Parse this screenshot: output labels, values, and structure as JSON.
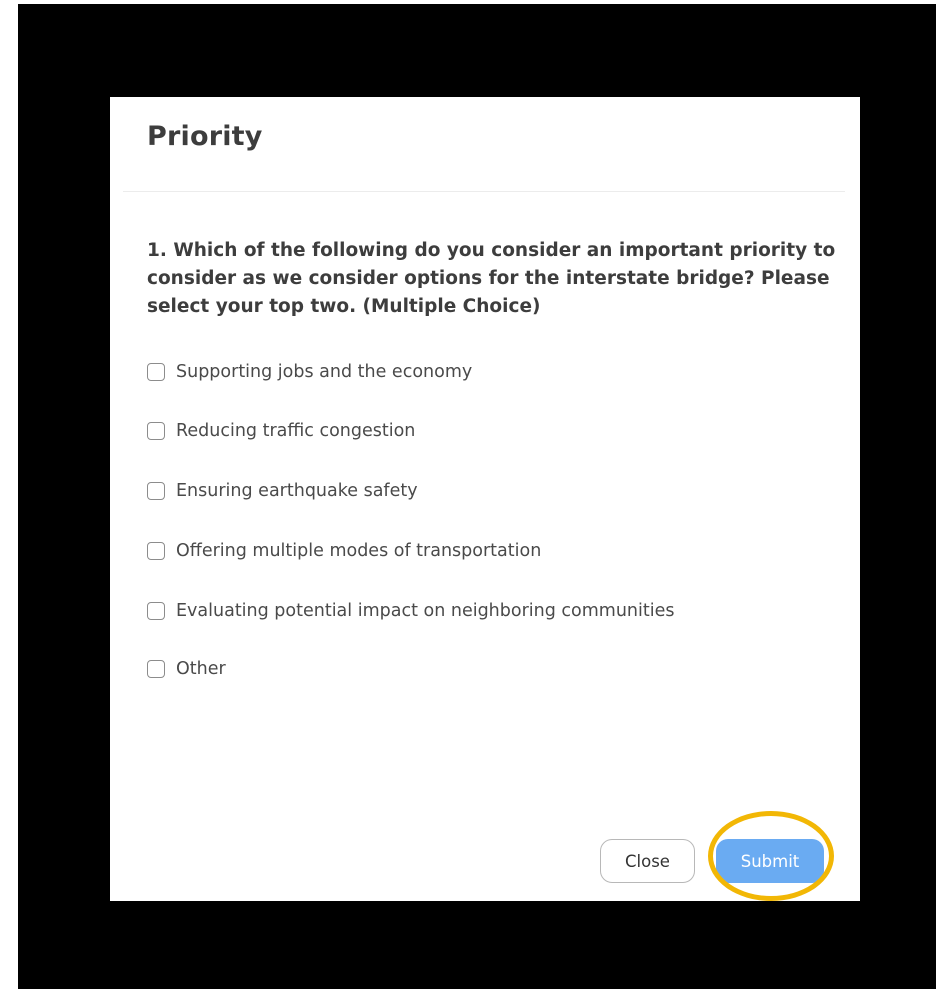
{
  "dialog": {
    "title": "Priority",
    "question": "1. Which of the following do you consider an important priority to consider as we consider options for the interstate bridge? Please select your top two. (Multiple Choice)",
    "options": [
      "Supporting jobs and the economy",
      "Reducing traffic congestion",
      "Ensuring earthquake safety",
      "Offering multiple modes of transportation",
      "Evaluating potential impact on neighboring communities",
      "Other"
    ],
    "close_label": "Close",
    "submit_label": "Submit"
  },
  "colors": {
    "backdrop": "#000000",
    "submit_button": "#6aabf2",
    "highlight_ring": "#f2b705",
    "text": "#3d3d3d"
  },
  "icons": {
    "checkbox": "checkbox-unchecked-icon"
  }
}
